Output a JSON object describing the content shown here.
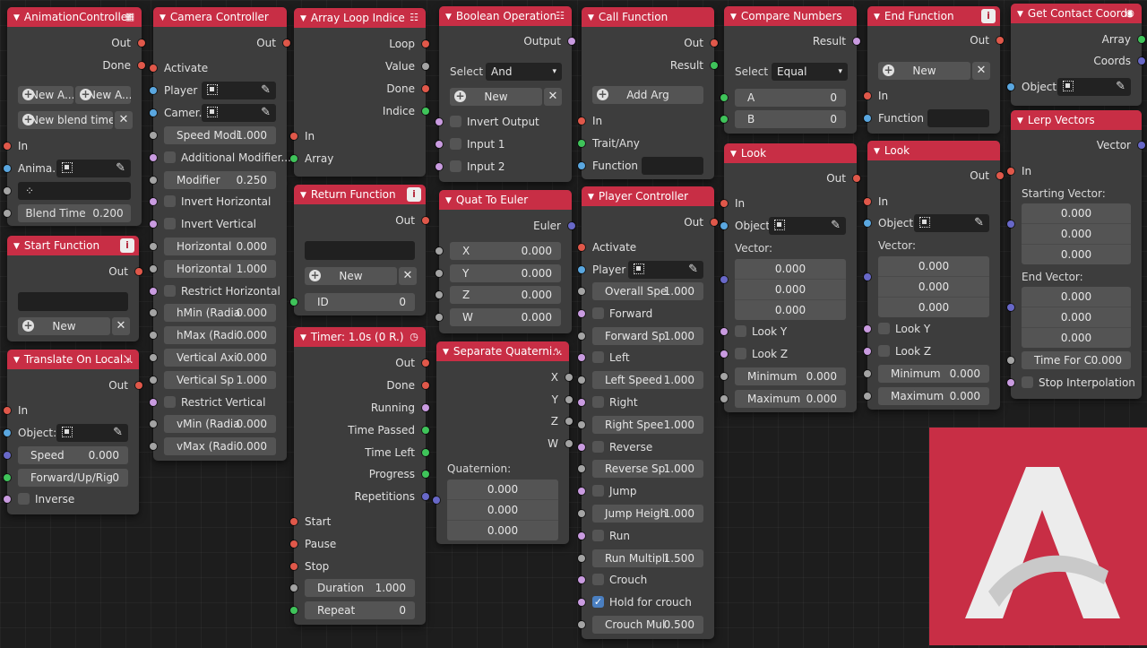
{
  "nodes": {
    "anim": {
      "title": "AnimationController",
      "out": "Out",
      "done": "Done",
      "new_a1": "New A...",
      "new_a2": "New A...",
      "new_blend": "New blend time",
      "in": "In",
      "anima": "Anima...",
      "blend_time_label": "Blend Time",
      "blend_time_val": "0.200"
    },
    "start": {
      "title": "Start Function",
      "out": "Out"
    },
    "translate": {
      "title": "Translate On Local...",
      "out": "Out",
      "in": "In",
      "object": "Object:",
      "speed_label": "Speed",
      "speed_val": "0.000",
      "fwd_label": "Forward/Up/Rig",
      "fwd_val": "0",
      "inverse": "Inverse"
    },
    "camera": {
      "title": "Camera Controller",
      "out": "Out",
      "activate": "Activate",
      "player": "Player ...",
      "camer": "Camer...",
      "rows": [
        {
          "kind": "field",
          "label": "Speed Modi",
          "val": "1.000"
        },
        {
          "kind": "check",
          "label": "Additional Modifier..."
        },
        {
          "kind": "field",
          "label": "Modifier",
          "val": "0.250"
        },
        {
          "kind": "check",
          "label": "Invert Horizontal"
        },
        {
          "kind": "check",
          "label": "Invert Vertical"
        },
        {
          "kind": "field",
          "label": "Horizontal",
          "val": "0.000"
        },
        {
          "kind": "field",
          "label": "Horizontal",
          "val": "1.000"
        },
        {
          "kind": "check",
          "label": "Restrict Horizontal"
        },
        {
          "kind": "field",
          "label": "hMin (Radia",
          "val": "0.000"
        },
        {
          "kind": "field",
          "label": "hMax (Radi",
          "val": "0.000"
        },
        {
          "kind": "field",
          "label": "Vertical Axi",
          "val": "0.000"
        },
        {
          "kind": "field",
          "label": "Vertical Sp",
          "val": "1.000"
        },
        {
          "kind": "check",
          "label": "Restrict Vertical"
        },
        {
          "kind": "field",
          "label": "vMin (Radia",
          "val": "0.000"
        },
        {
          "kind": "field",
          "label": "vMax (Radi",
          "val": "0.000"
        }
      ]
    },
    "arrayloop": {
      "title": "Array Loop Indice",
      "loop": "Loop",
      "value": "Value",
      "done": "Done",
      "indice": "Indice",
      "in": "In",
      "array": "Array"
    },
    "returnfn": {
      "title": "Return Function",
      "out": "Out",
      "new": "New",
      "id_label": "ID",
      "id_val": "0"
    },
    "timer": {
      "title": "Timer: 1.0s (0 R.)",
      "out": "Out",
      "done": "Done",
      "running": "Running",
      "time_passed": "Time Passed",
      "time_left": "Time Left",
      "progress": "Progress",
      "repetitions": "Repetitions",
      "start": "Start",
      "pause": "Pause",
      "stop": "Stop",
      "duration_label": "Duration",
      "duration_val": "1.000",
      "repeat_label": "Repeat",
      "repeat_val": "0"
    },
    "boolop": {
      "title": "Boolean Operation",
      "output": "Output",
      "select_label": "Select ...",
      "select_val": "And",
      "new": "New",
      "invert": "Invert Output",
      "input1": "Input 1",
      "input2": "Input 2"
    },
    "quat": {
      "title": "Quat To Euler",
      "euler": "Euler",
      "x": "X",
      "x_val": "0.000",
      "y": "Y",
      "y_val": "0.000",
      "z": "Z",
      "z_val": "0.000",
      "w": "W",
      "w_val": "0.000"
    },
    "sepq": {
      "title": "Separate Quaterni...",
      "x": "X",
      "y": "Y",
      "z": "Z",
      "w": "W",
      "quaternion": "Quaternion:",
      "q1": "0.000",
      "q2": "0.000",
      "q3": "0.000"
    },
    "callfn": {
      "title": "Call Function",
      "out": "Out",
      "result": "Result",
      "add_arg": "Add Arg",
      "in": "In",
      "trait": "Trait/Any",
      "function": "Function"
    },
    "player": {
      "title": "Player Controller",
      "out": "Out",
      "activate": "Activate",
      "player": "Player",
      "rows": [
        {
          "kind": "field",
          "label": "Overall Spe",
          "val": "1.000"
        },
        {
          "kind": "check",
          "label": "Forward",
          "on": false
        },
        {
          "kind": "field",
          "label": "Forward Sp",
          "val": "1.000"
        },
        {
          "kind": "check",
          "label": "Left",
          "on": false
        },
        {
          "kind": "field",
          "label": "Left Speed",
          "val": "1.000"
        },
        {
          "kind": "check",
          "label": "Right",
          "on": false
        },
        {
          "kind": "field",
          "label": "Right Spee",
          "val": "1.000"
        },
        {
          "kind": "check",
          "label": "Reverse",
          "on": false
        },
        {
          "kind": "field",
          "label": "Reverse Sp",
          "val": "1.000"
        },
        {
          "kind": "check",
          "label": "Jump",
          "on": false
        },
        {
          "kind": "field",
          "label": "Jump Heigh",
          "val": "1.000"
        },
        {
          "kind": "check",
          "label": "Run",
          "on": false
        },
        {
          "kind": "field",
          "label": "Run Multipli",
          "val": "1.500"
        },
        {
          "kind": "check",
          "label": "Crouch",
          "on": false
        },
        {
          "kind": "check",
          "label": "Hold for crouch",
          "on": true
        },
        {
          "kind": "field",
          "label": "Crouch Mul",
          "val": "0.500"
        }
      ]
    },
    "compare": {
      "title": "Compare Numbers",
      "result": "Result",
      "select_label": "Select ...",
      "select_val": "Equal",
      "a": "A",
      "a_val": "0",
      "b": "B",
      "b_val": "0"
    },
    "look1": {
      "title": "Look",
      "out": "Out",
      "in": "In",
      "object": "Object:",
      "vector": "Vector:",
      "v1": "0.000",
      "v2": "0.000",
      "v3": "0.000",
      "looky": "Look Y",
      "lookz": "Look Z",
      "min_label": "Minimum",
      "min_val": "0.000",
      "max_label": "Maximum",
      "max_val": "0.000"
    },
    "endfn": {
      "title": "End Function",
      "out": "Out",
      "new": "New",
      "in": "In",
      "function": "Function"
    },
    "look2": {
      "title": "Look",
      "out": "Out",
      "in": "In",
      "object": "Object:",
      "vector": "Vector:",
      "v1": "0.000",
      "v2": "0.000",
      "v3": "0.000",
      "looky": "Look Y",
      "lookz": "Look Z",
      "min_label": "Minimum",
      "min_val": "0.000",
      "max_label": "Maximum",
      "max_val": "0.000"
    },
    "contact": {
      "title": "Get Contact Coords",
      "array": "Array",
      "coords": "Coords",
      "object": "Object:"
    },
    "lerp": {
      "title": "Lerp Vectors",
      "vector": "Vector",
      "in": "In",
      "starting": "Starting Vector:",
      "s1": "0.000",
      "s2": "0.000",
      "s3": "0.000",
      "ending": "End Vector:",
      "e1": "0.000",
      "e2": "0.000",
      "e3": "0.000",
      "time_label": "Time For C",
      "time_val": "0.000",
      "stop": "Stop Interpolation"
    }
  },
  "colors": {
    "header": "#c82e45",
    "node_bg": "#3d3d3d",
    "logo_bg": "#c82e45"
  }
}
